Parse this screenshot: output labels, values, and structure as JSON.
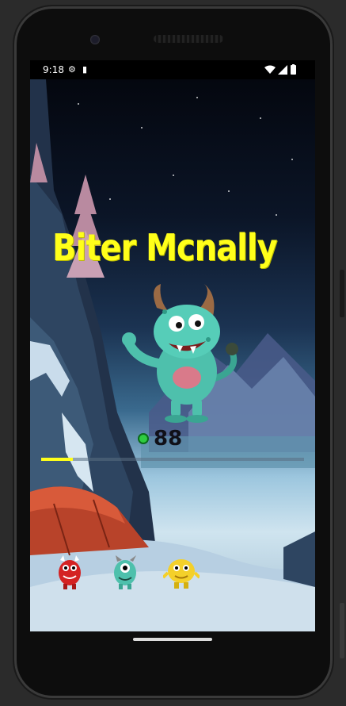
{
  "status_bar": {
    "time": "9:18",
    "icons": [
      "settings-icon",
      "sim-icon",
      "wifi-icon",
      "signal-icon",
      "battery-icon"
    ]
  },
  "game": {
    "monster_name": "Biter Mcnally",
    "score": "88",
    "progress_fraction": 0.12,
    "colors": {
      "title": "#ffff1a",
      "progress_fill": "#ffff1a",
      "gem": "#2ecc40"
    },
    "monster_options": [
      "red-monster",
      "teal-monster",
      "yellow-monster"
    ]
  }
}
